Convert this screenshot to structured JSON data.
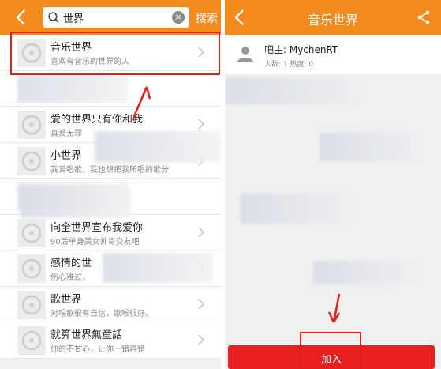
{
  "left": {
    "search": {
      "value": "世界",
      "button_label": "搜索"
    },
    "items": [
      {
        "title": "音乐世界",
        "subtitle": "喜欢有音乐的世界的人",
        "blurred": false
      },
      {
        "title": "",
        "subtitle": "",
        "blurred": true
      },
      {
        "title": "爱的世界只有你和我",
        "subtitle": "真爱无罪",
        "blurred": false
      },
      {
        "title": "小世界",
        "subtitle": "我爱唱歌，我也想把我所唱的歌分",
        "blurred": false
      },
      {
        "title": "",
        "subtitle": "",
        "blurred": true
      },
      {
        "title": "向全世界宣布我爱你",
        "subtitle": "90后单身美女帅哥交友吧",
        "blurred": false
      },
      {
        "title": "感情的世",
        "subtitle": "伤心难过，",
        "blurred": false
      },
      {
        "title": "歌世界",
        "subtitle": "对唱歌很有自信，歌喉很好。",
        "blurred": false
      },
      {
        "title": "就算世界無童話",
        "subtitle": "你的不甘心，让你一错再错",
        "blurred": false
      }
    ]
  },
  "right": {
    "title": "音乐世界",
    "owner_label": "吧主: MychenRT",
    "stats": "人数: 1  热度: 0",
    "join_label": "加入"
  },
  "colors": {
    "header": "#f28a1e",
    "join": "#ea2020",
    "highlight": "#e0201c"
  }
}
